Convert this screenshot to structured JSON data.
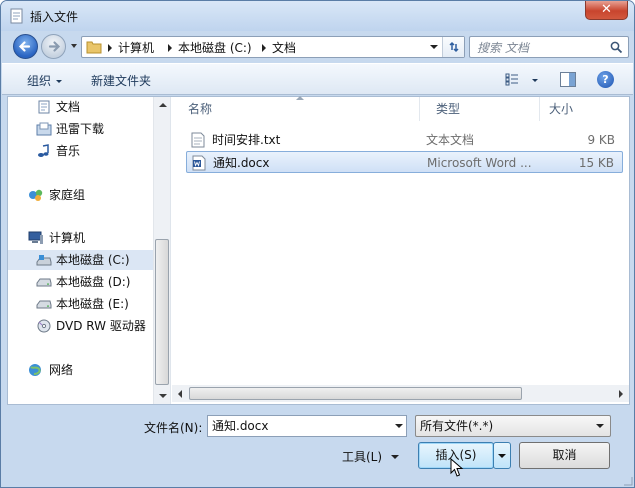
{
  "window": {
    "title": "插入文件"
  },
  "navigation": {
    "breadcrumbs": [
      "计算机",
      "本地磁盘 (C:)",
      "文档"
    ],
    "search_placeholder": "搜索 文档"
  },
  "toolbar": {
    "organize": "组织",
    "new_folder": "新建文件夹"
  },
  "sidebar": {
    "items": [
      {
        "label": "文档",
        "icon": "documents-icon"
      },
      {
        "label": "迅雷下载",
        "icon": "download-folder-icon"
      },
      {
        "label": "音乐",
        "icon": "music-icon"
      },
      {
        "label": "家庭组",
        "icon": "homegroup-icon"
      },
      {
        "label": "计算机",
        "icon": "computer-icon"
      },
      {
        "label": "本地磁盘 (C:)",
        "icon": "drive-c-icon",
        "selected": true
      },
      {
        "label": "本地磁盘 (D:)",
        "icon": "drive-icon"
      },
      {
        "label": "本地磁盘 (E:)",
        "icon": "drive-icon"
      },
      {
        "label": "DVD RW 驱动器",
        "icon": "dvd-drive-icon"
      },
      {
        "label": "网络",
        "icon": "network-icon"
      }
    ]
  },
  "file_list": {
    "columns": {
      "name": "名称",
      "type": "类型",
      "size": "大小"
    },
    "rows": [
      {
        "name": "时间安排.txt",
        "type": "文本文档",
        "size": "9 KB",
        "icon": "text-file-icon",
        "selected": false
      },
      {
        "name": "通知.docx",
        "type": "Microsoft Word ...",
        "size": "15 KB",
        "icon": "word-file-icon",
        "selected": true
      }
    ]
  },
  "footer": {
    "filename_label": "文件名(N):",
    "filename_value": "通知.docx",
    "filter_value": "所有文件(*.*)",
    "tools_label": "工具(L)",
    "insert_label": "插入(S)",
    "cancel_label": "取消"
  }
}
